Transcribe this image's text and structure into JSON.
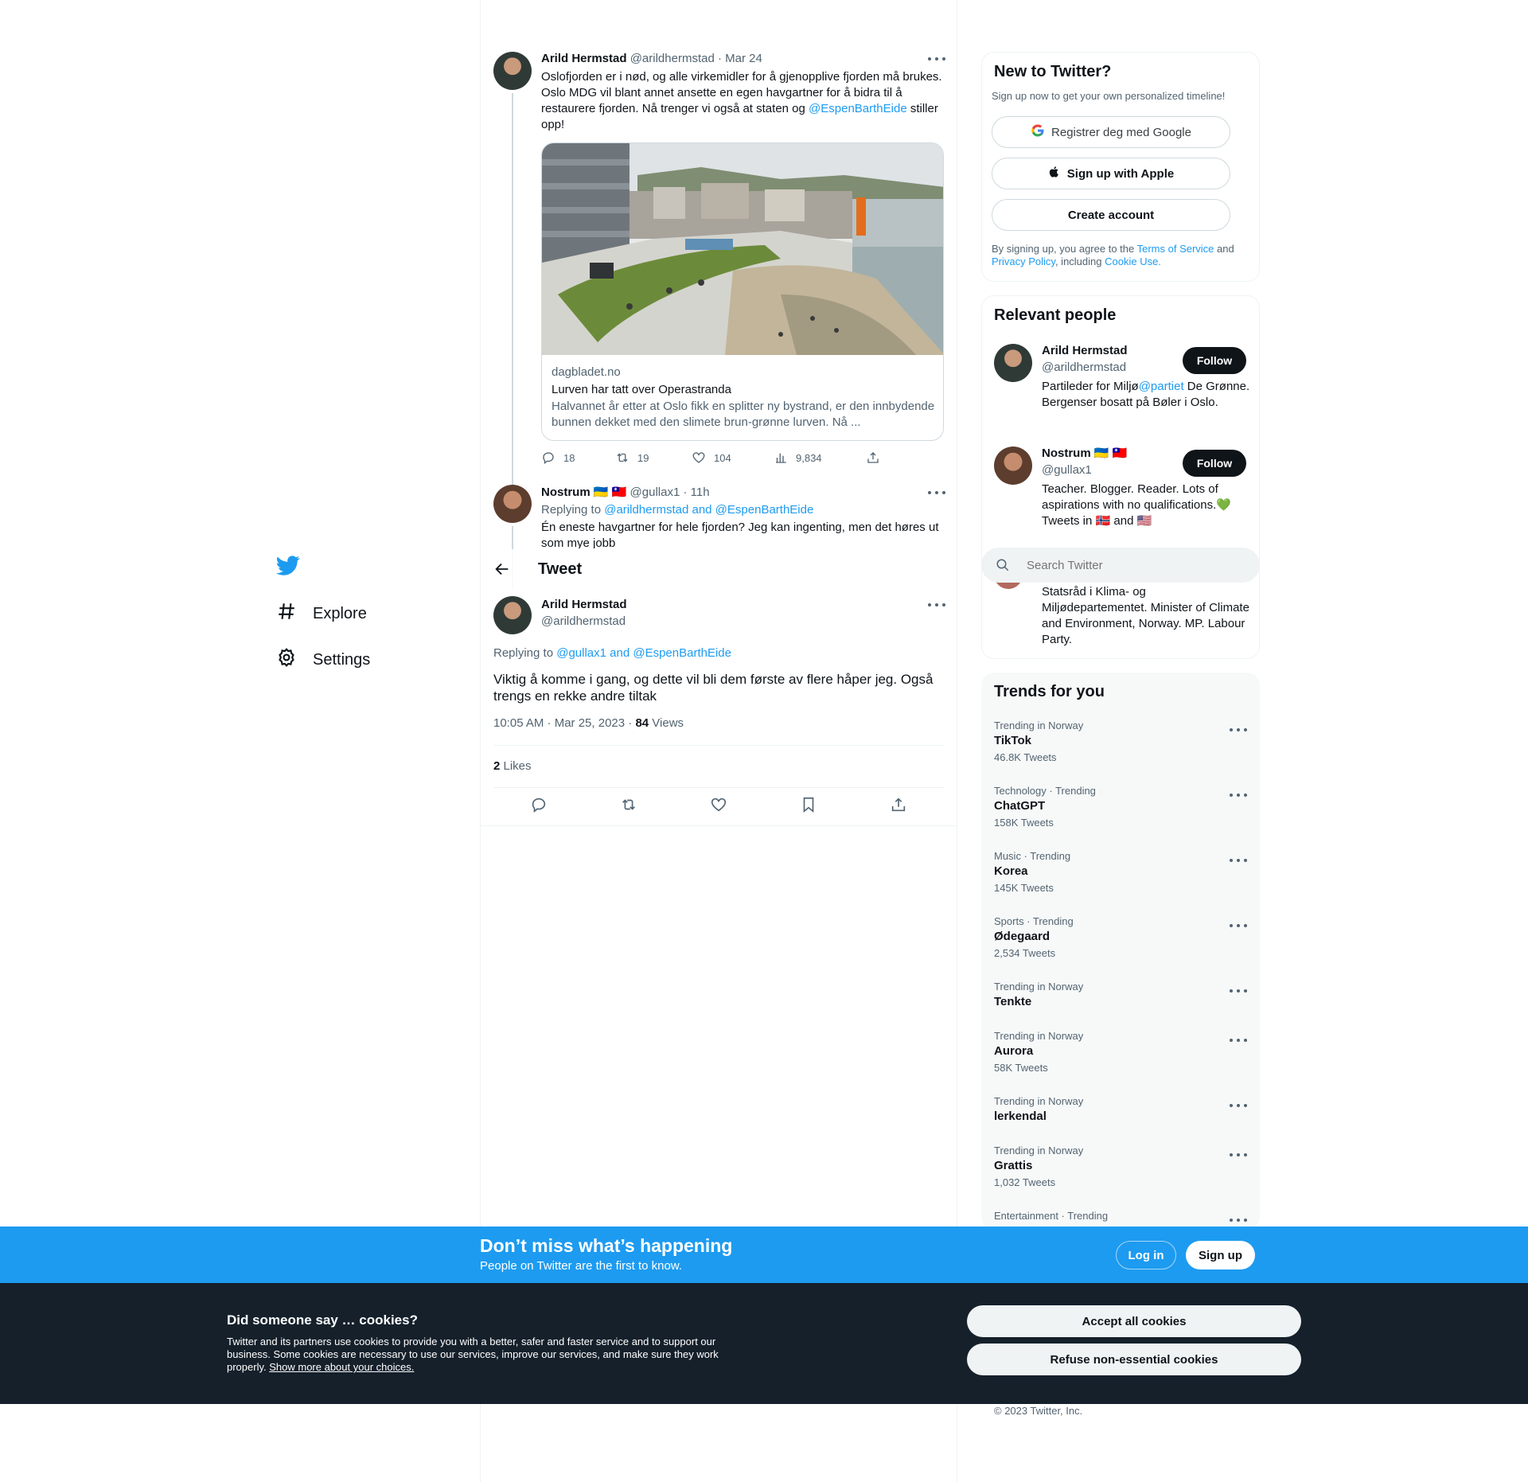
{
  "nav": {
    "explore_label": "Explore",
    "settings_label": "Settings"
  },
  "header": {
    "title": "Tweet"
  },
  "parent_tweet": {
    "author_name": "Arild Hermstad",
    "author_handle": "@arildhermstad",
    "date": "· Mar 24",
    "text_part1": "Oslofjorden er i nød, og alle virkemidler for å gjenopplive fjorden må brukes. Oslo MDG vil blant annet ansette en egen havgartner for å bidra til å restaurere fjorden. Nå trenger vi også at staten og ",
    "text_mention": "@EspenBarthEide",
    "text_part2": " stiller opp!",
    "card_domain": "dagbladet.no",
    "card_title": "Lurven har tatt over Operastranda",
    "card_desc": "Halvannet år etter at Oslo fikk en splitter ny bystrand, er den innbydende bunnen dekket med den slimete brun-grønne lurven. Nå ...",
    "replies": "18",
    "retweets": "19",
    "likes": "104",
    "views": "9,834"
  },
  "reply_tweet": {
    "author_name": "Nostrum",
    "flags": "🇺🇦 🇹🇼",
    "author_handle": "@gullax1",
    "date": "· 11h",
    "replying_prefix": "Replying to ",
    "replying_to": "@arildhermstad and @EspenBarthEide",
    "text": "Én eneste havgartner for hele fjorden? Jeg kan ingenting, men det høres ut som mye jobb"
  },
  "main_tweet": {
    "author_name": "Arild Hermstad",
    "author_handle": "@arildhermstad",
    "replying_prefix": "Replying to ",
    "replying_to": "@gullax1 and @EspenBarthEide",
    "text": "Viktig å komme i gang, og dette vil bli dem første av flere håper jeg. Også trengs en rekke andre tiltak",
    "timestamp": "10:05 AM · Mar 25, 2023 · ",
    "views_count": "84",
    "views_label": " Views",
    "likes_count": "2",
    "likes_label": " Likes"
  },
  "signup": {
    "title": "New to Twitter?",
    "subtitle": "Sign up now to get your own personalized timeline!",
    "google_label": "Registrer deg med Google",
    "apple_label": "Sign up with Apple",
    "create_label": "Create account",
    "terms_prefix": "By signing up, you agree to the ",
    "terms_link": "Terms of Service",
    "terms_and": " and",
    "privacy_link": "Privacy Policy",
    "terms_including": ", including ",
    "cookie_link": "Cookie Use."
  },
  "relevant": {
    "title": "Relevant people",
    "people": [
      {
        "name": "Arild Hermstad",
        "handle": "@arildhermstad",
        "bio_part1": "Partileder for Miljø",
        "bio_mention": "@partiet",
        "bio_part2": " De Grønne. Bergenser bosatt på Bøler i Oslo.",
        "follow_label": "Follow"
      },
      {
        "name": "Nostrum",
        "flags": "🇺🇦 🇹🇼",
        "handle": "@gullax1",
        "bio_part1": "Teacher. Blogger. Reader. Lots of aspirations with no qualifications.",
        "bio_heart": "💚",
        "bio_part2": "Tweets in ",
        "bio_flag1": "🇳🇴",
        "bio_and": " and ",
        "bio_flag2": "🇺🇸",
        "follow_label": "Follow"
      },
      {
        "bio": "Statsråd i Klima- og Miljødepartementet. Minister of Climate and Environment, Norway. MP. Labour Party."
      }
    ]
  },
  "search": {
    "placeholder": "Search Twitter"
  },
  "trends": {
    "title": "Trends for you",
    "items": [
      {
        "context": "Trending in Norway",
        "name": "TikTok",
        "count": "46.8K Tweets"
      },
      {
        "context": "Technology · Trending",
        "name": "ChatGPT",
        "count": "158K Tweets"
      },
      {
        "context": "Music · Trending",
        "name": "Korea",
        "count": "145K Tweets"
      },
      {
        "context": "Sports · Trending",
        "name": "Ødegaard",
        "count": "2,534 Tweets"
      },
      {
        "context": "Trending in Norway",
        "name": "Tenkte",
        "count": ""
      },
      {
        "context": "Trending in Norway",
        "name": "Aurora",
        "count": "58K Tweets"
      },
      {
        "context": "Trending in Norway",
        "name": "lerkendal",
        "count": ""
      },
      {
        "context": "Trending in Norway",
        "name": "Grattis",
        "count": "1,032 Tweets"
      },
      {
        "context": "Entertainment · Trending",
        "name": "",
        "count": ""
      }
    ]
  },
  "banner": {
    "title": "Don’t miss what’s happening",
    "subtitle": "People on Twitter are the first to know.",
    "login_label": "Log in",
    "signup_label": "Sign up"
  },
  "cookies": {
    "title": "Did someone say … cookies?",
    "body": "Twitter and its partners use cookies to provide you with a better, safer and faster service and to support our business. Some cookies are necessary to use our services, improve our services, and make sure they work properly. ",
    "link": "Show more about your choices.",
    "accept_label": "Accept all cookies",
    "refuse_label": "Refuse non-essential cookies"
  },
  "footer": {
    "copyright": "© 2023 Twitter, Inc."
  },
  "colors": {
    "accent": "#1d9bf0",
    "text": "#0f1419",
    "muted": "#536471",
    "cookie_bg": "#15202b"
  }
}
